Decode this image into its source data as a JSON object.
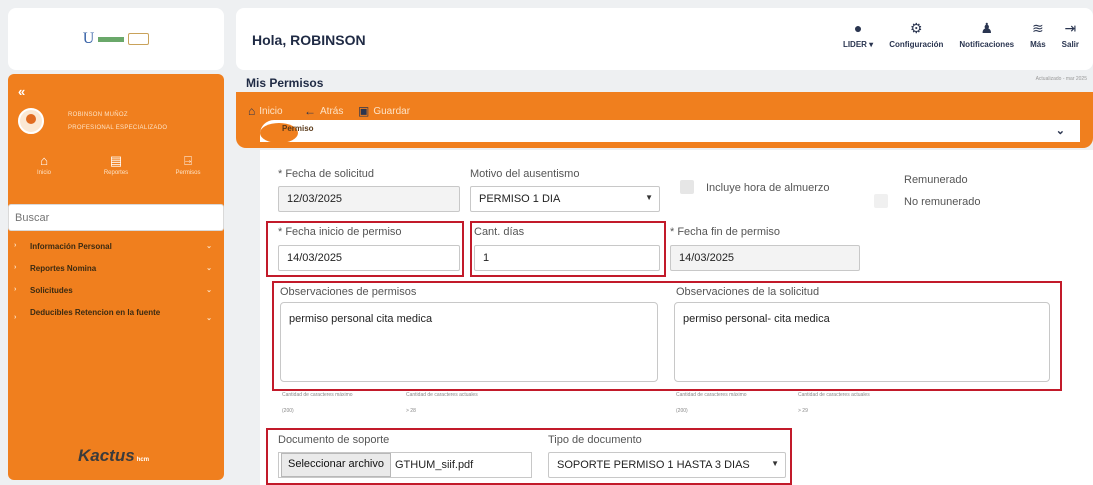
{
  "header": {
    "greeting": "Hola, ROBINSON",
    "actions": [
      {
        "label": "LIDER ▾",
        "icon": "user-icon"
      },
      {
        "label": "Configuración",
        "icon": "gear-icon"
      },
      {
        "label": "Notificaciones",
        "icon": "bell-icon"
      },
      {
        "label": "Más",
        "icon": "layers-icon"
      },
      {
        "label": "Salir",
        "icon": "logout-icon"
      }
    ]
  },
  "sidebar": {
    "collapse": "«",
    "user_name": "ROBINSON MUÑOZ",
    "user_role": "PROFESIONAL ESPECIALIZADO",
    "nav": [
      {
        "label": "Inicio",
        "icon": "home-icon"
      },
      {
        "label": "Reportes",
        "icon": "report-icon"
      },
      {
        "label": "Permisos",
        "icon": "door-icon"
      }
    ],
    "search_placeholder": "Buscar",
    "menu": [
      {
        "label": "Información Personal"
      },
      {
        "label": "Reportes Nomina"
      },
      {
        "label": "Solicitudes"
      },
      {
        "label": "Deducibles Retencion en la fuente"
      }
    ],
    "brand": "Kactus",
    "brand_suffix": "hcm"
  },
  "page": {
    "title": "Mis Permisos",
    "last_update": "Actualizado - mar 2025"
  },
  "toolbar": {
    "home": "Inicio",
    "back": "Atrás",
    "save": "Guardar"
  },
  "section": {
    "title": "Permiso"
  },
  "form": {
    "fecha_solicitud_label": "* Fecha de solicitud",
    "fecha_solicitud": "12/03/2025",
    "motivo_label": "Motivo del ausentismo",
    "motivo": "PERMISO 1 DIA",
    "almuerzo_label": "Incluye hora de almuerzo",
    "remunerado_label": "Remunerado",
    "no_remunerado_label": "No remunerado",
    "fecha_inicio_label": "* Fecha inicio de permiso",
    "fecha_inicio": "14/03/2025",
    "cant_dias_label": "Cant. días",
    "cant_dias": "1",
    "fecha_fin_label": "* Fecha fin de permiso",
    "fecha_fin": "14/03/2025",
    "obs_permisos_label": "Observaciones de permisos",
    "obs_permisos": "permiso personal cita medica",
    "obs_solicitud_label": "Observaciones de la solicitud",
    "obs_solicitud": "permiso personal- cita medica",
    "max_chars_label": "Cantidad de caracteres máximo",
    "cur_chars_label": "Cantidad de caracteres actuales",
    "max_chars": "(200)",
    "cur_chars_1": "> 28",
    "cur_chars_2": "> 29",
    "documento_label": "Documento de soporte",
    "file_button": "Seleccionar archivo",
    "file_name": "GTHUM_siif.pdf",
    "tipo_doc_label": "Tipo de documento",
    "tipo_doc": "SOPORTE PERMISO 1 HASTA 3 DIAS"
  },
  "colors": {
    "accent": "#f07f1e",
    "highlight": "#c21a2a",
    "dark": "#1f2a44"
  }
}
